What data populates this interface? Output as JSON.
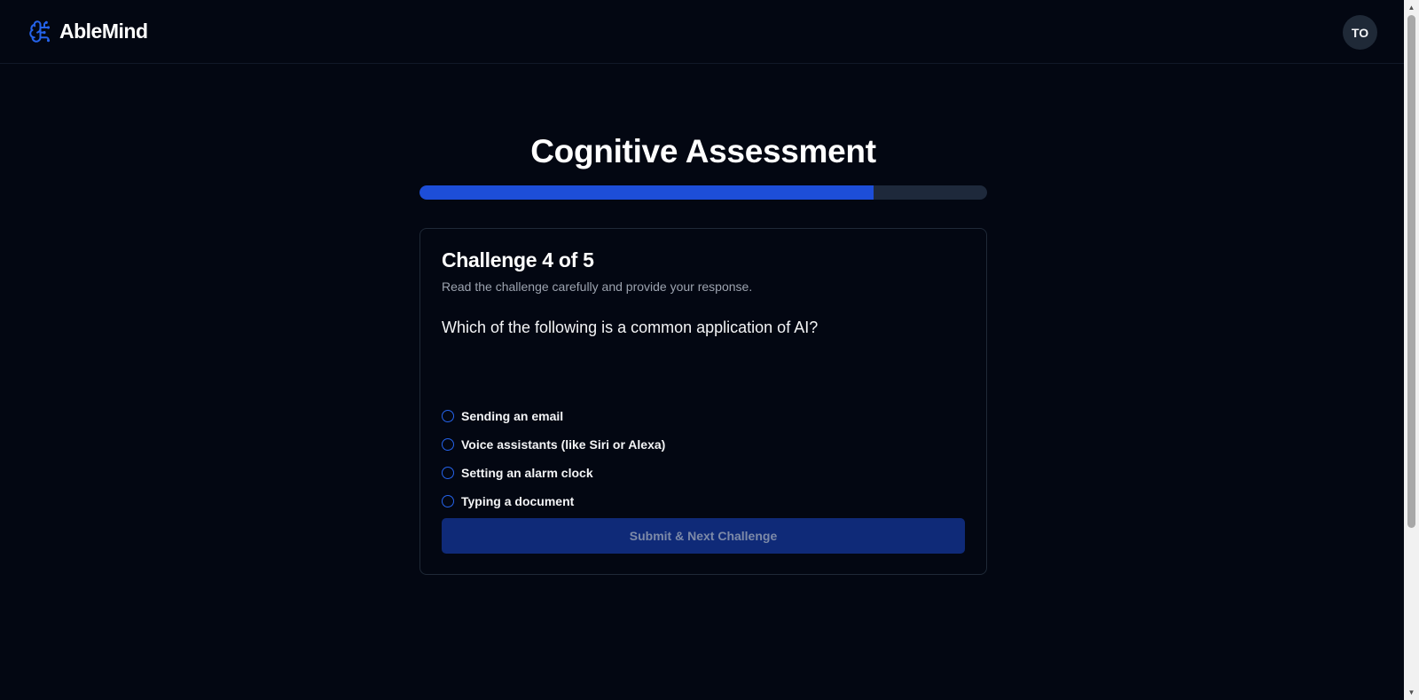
{
  "header": {
    "brand_name": "AbleMind",
    "brand_icon": "brain-icon",
    "avatar_initials": "TO"
  },
  "main": {
    "title": "Cognitive Assessment",
    "progress_fraction": 0.8,
    "card": {
      "challenge_title": "Challenge 4 of 5",
      "challenge_description": "Read the challenge carefully and provide your response.",
      "question": "Which of the following is a common application of AI?",
      "options": [
        {
          "label": "Sending an email",
          "selected": false
        },
        {
          "label": "Voice assistants (like Siri or Alexa)",
          "selected": false
        },
        {
          "label": "Setting an alarm clock",
          "selected": false
        },
        {
          "label": "Typing a document",
          "selected": false
        }
      ],
      "submit_label": "Submit & Next Challenge",
      "submit_disabled": true
    }
  },
  "colors": {
    "background": "#030712",
    "accent": "#1d4ed8",
    "progress_track": "#1e293b",
    "submit_disabled_bg": "#0f2a78",
    "muted_text": "#9ca3af"
  }
}
